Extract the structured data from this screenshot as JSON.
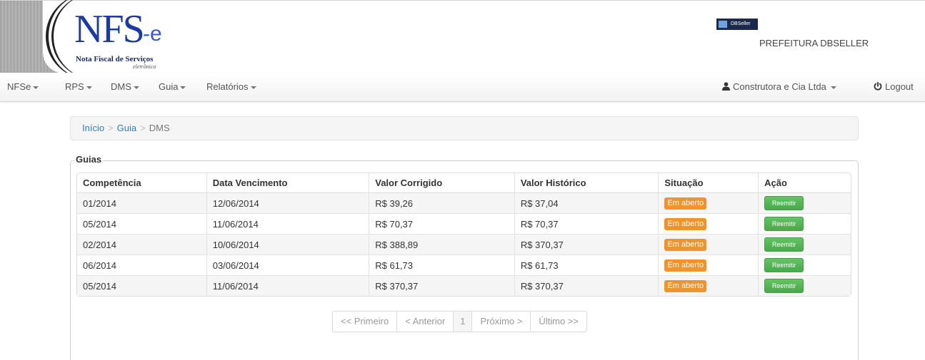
{
  "header": {
    "logo_main": "NFS",
    "logo_e": "e",
    "logo_subtitle": "Nota Fiscal de Serviços",
    "logo_subtitle2": "eletrônica",
    "dbseller_badge": "DBSeller",
    "prefeitura": "PREFEITURA DBSELLER"
  },
  "nav": {
    "items": [
      {
        "label": "NFSe"
      },
      {
        "label": "RPS"
      },
      {
        "label": "DMS"
      },
      {
        "label": "Guia"
      },
      {
        "label": "Relatórios"
      }
    ],
    "user_label": "Construtora e Cia Ltda",
    "logout_label": "Logout",
    "user_icon": "user-icon",
    "logout_icon": "power-icon"
  },
  "breadcrumb": {
    "items": [
      "Início",
      "Guia",
      "DMS"
    ],
    "separator": ">"
  },
  "guias": {
    "legend": "Guias",
    "columns": [
      "Competência",
      "Data Vencimento",
      "Valor Corrigido",
      "Valor Histórico",
      "Situação",
      "Ação"
    ],
    "rows": [
      {
        "competencia": "01/2014",
        "vencimento": "12/06/2014",
        "corrigido": "R$ 39,26",
        "historico": "R$ 37,04",
        "situacao": "Em aberto",
        "acao": "Reemitir"
      },
      {
        "competencia": "05/2014",
        "vencimento": "11/06/2014",
        "corrigido": "R$ 70,37",
        "historico": "R$ 70,37",
        "situacao": "Em aberto",
        "acao": "Reemitir"
      },
      {
        "competencia": "02/2014",
        "vencimento": "10/06/2014",
        "corrigido": "R$ 388,89",
        "historico": "R$ 370,37",
        "situacao": "Em aberto",
        "acao": "Reemitir"
      },
      {
        "competencia": "06/2014",
        "vencimento": "03/06/2014",
        "corrigido": "R$ 61,73",
        "historico": "R$ 61,73",
        "situacao": "Em aberto",
        "acao": "Reemitir"
      },
      {
        "competencia": "05/2014",
        "vencimento": "11/06/2014",
        "corrigido": "R$ 370,37",
        "historico": "R$ 370,37",
        "situacao": "Em aberto",
        "acao": "Reemitir"
      }
    ]
  },
  "pagination": {
    "first": "<< Primeiro",
    "prev": "< Anterior",
    "current": "1",
    "next": "Próximo >",
    "last": "Último >>"
  },
  "colors": {
    "brand_blue": "#1b3aa6",
    "link": "#2a7fc4",
    "badge_orange": "#f0932b",
    "button_green": "#5cb85c"
  }
}
